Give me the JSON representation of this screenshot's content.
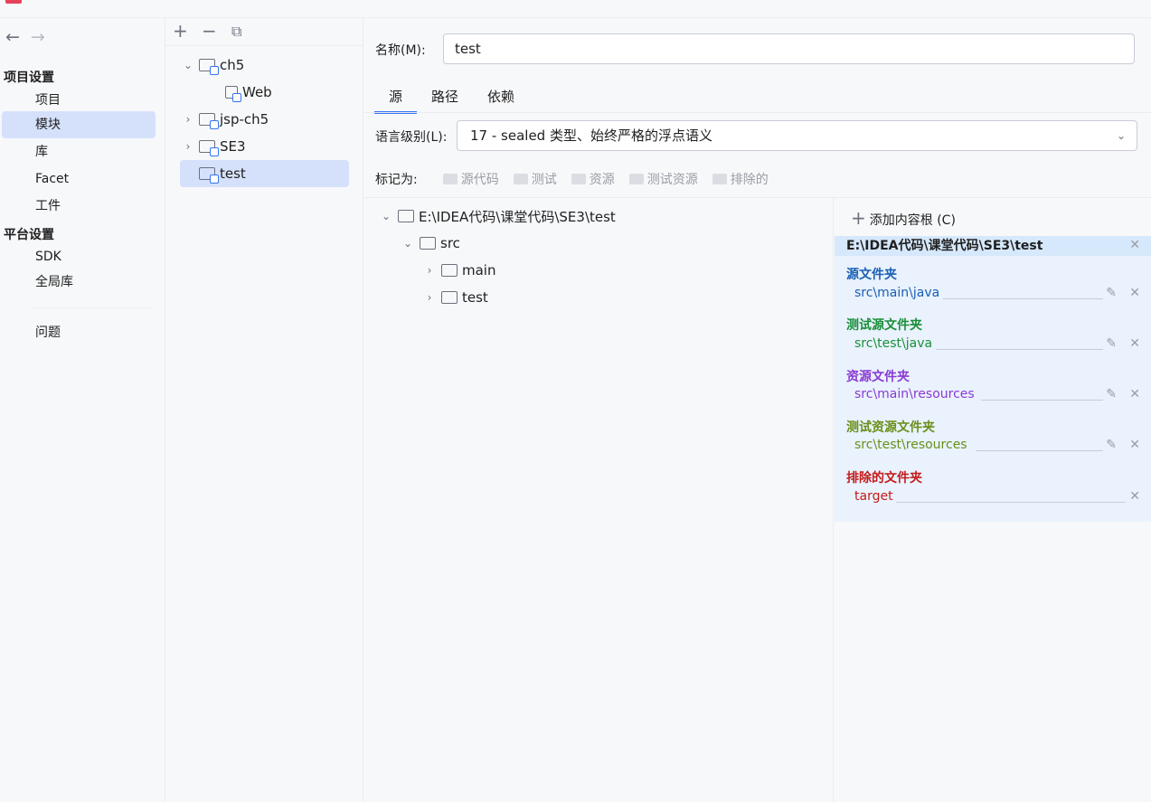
{
  "nav": {
    "section_project": "项目设置",
    "items_project": [
      "项目",
      "模块",
      "库",
      "Facet",
      "工件"
    ],
    "section_platform": "平台设置",
    "items_platform": [
      "SDK",
      "全局库"
    ],
    "problems": "问题"
  },
  "modules": {
    "items": [
      {
        "label": "ch5",
        "expanded": true
      },
      {
        "label": "Web"
      },
      {
        "label": "jsp-ch5"
      },
      {
        "label": "SE3"
      },
      {
        "label": "test",
        "selected": true
      }
    ]
  },
  "main": {
    "name_label": "名称(M):",
    "name_value": "test",
    "tabs": [
      "源",
      "路径",
      "依赖"
    ],
    "lang_label": "语言级别(L):",
    "lang_value": "17 - sealed 类型、始终严格的浮点语义",
    "mark_label": "标记为:",
    "mark_items": [
      "源代码",
      "测试",
      "资源",
      "测试资源",
      "排除的"
    ]
  },
  "tree": {
    "root": "E:\\IDEA代码\\课堂代码\\SE3\\test",
    "src": "src",
    "main": "main",
    "test": "test"
  },
  "roots": {
    "add_label": "添加内容根 (C)",
    "root_path": "E:\\IDEA代码\\课堂代码\\SE3\\test",
    "groups": [
      {
        "title": "源文件夹",
        "path": "src\\main\\java",
        "color": "#1a5fb4"
      },
      {
        "title": "测试源文件夹",
        "path": "src\\test\\java",
        "color": "#1a8f3a"
      },
      {
        "title": "资源文件夹",
        "path": "src\\main\\resources",
        "color": "#8a3ad4"
      },
      {
        "title": "测试资源文件夹",
        "path": "src\\test\\resources",
        "color": "#6a8f1a"
      },
      {
        "title": "排除的文件夹",
        "path": "target",
        "color": "#c41b1b"
      }
    ]
  }
}
